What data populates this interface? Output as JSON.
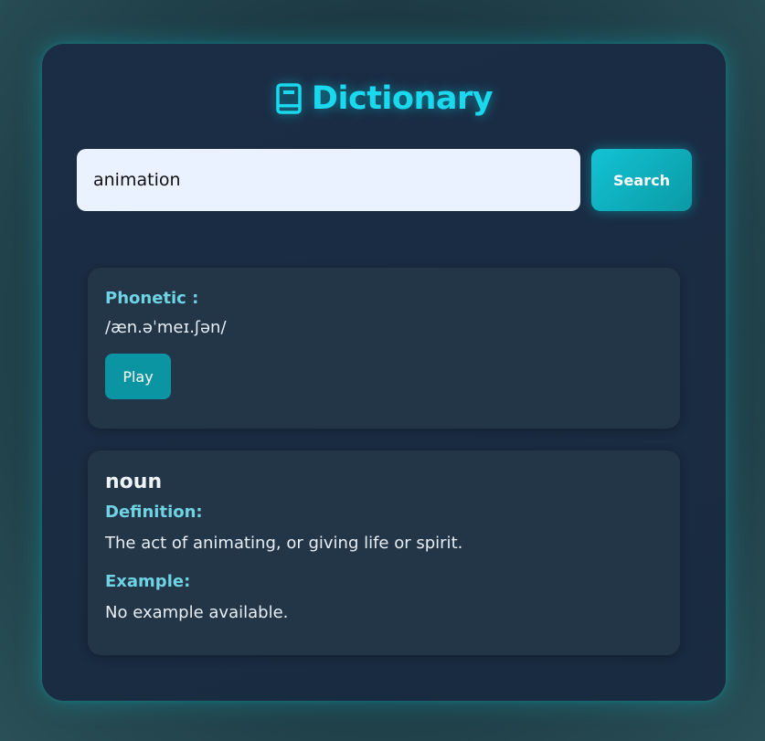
{
  "header": {
    "title": "Dictionary",
    "icon": "book-icon"
  },
  "search": {
    "value": "animation",
    "button_label": "Search"
  },
  "phonetic": {
    "label": "Phonetic :",
    "text": "/æn.əˈmeɪ.ʃən/",
    "play_label": "Play"
  },
  "meaning": {
    "part_of_speech": "noun",
    "definition_label": "Definition:",
    "definition": "The act of animating, or giving life or spirit.",
    "example_label": "Example:",
    "example": "No example available."
  },
  "colors": {
    "accent": "#1ad9ee",
    "button": "#0b95a3",
    "label": "#6fd3e3",
    "panel": "#1b2d45",
    "card": "#223648"
  }
}
